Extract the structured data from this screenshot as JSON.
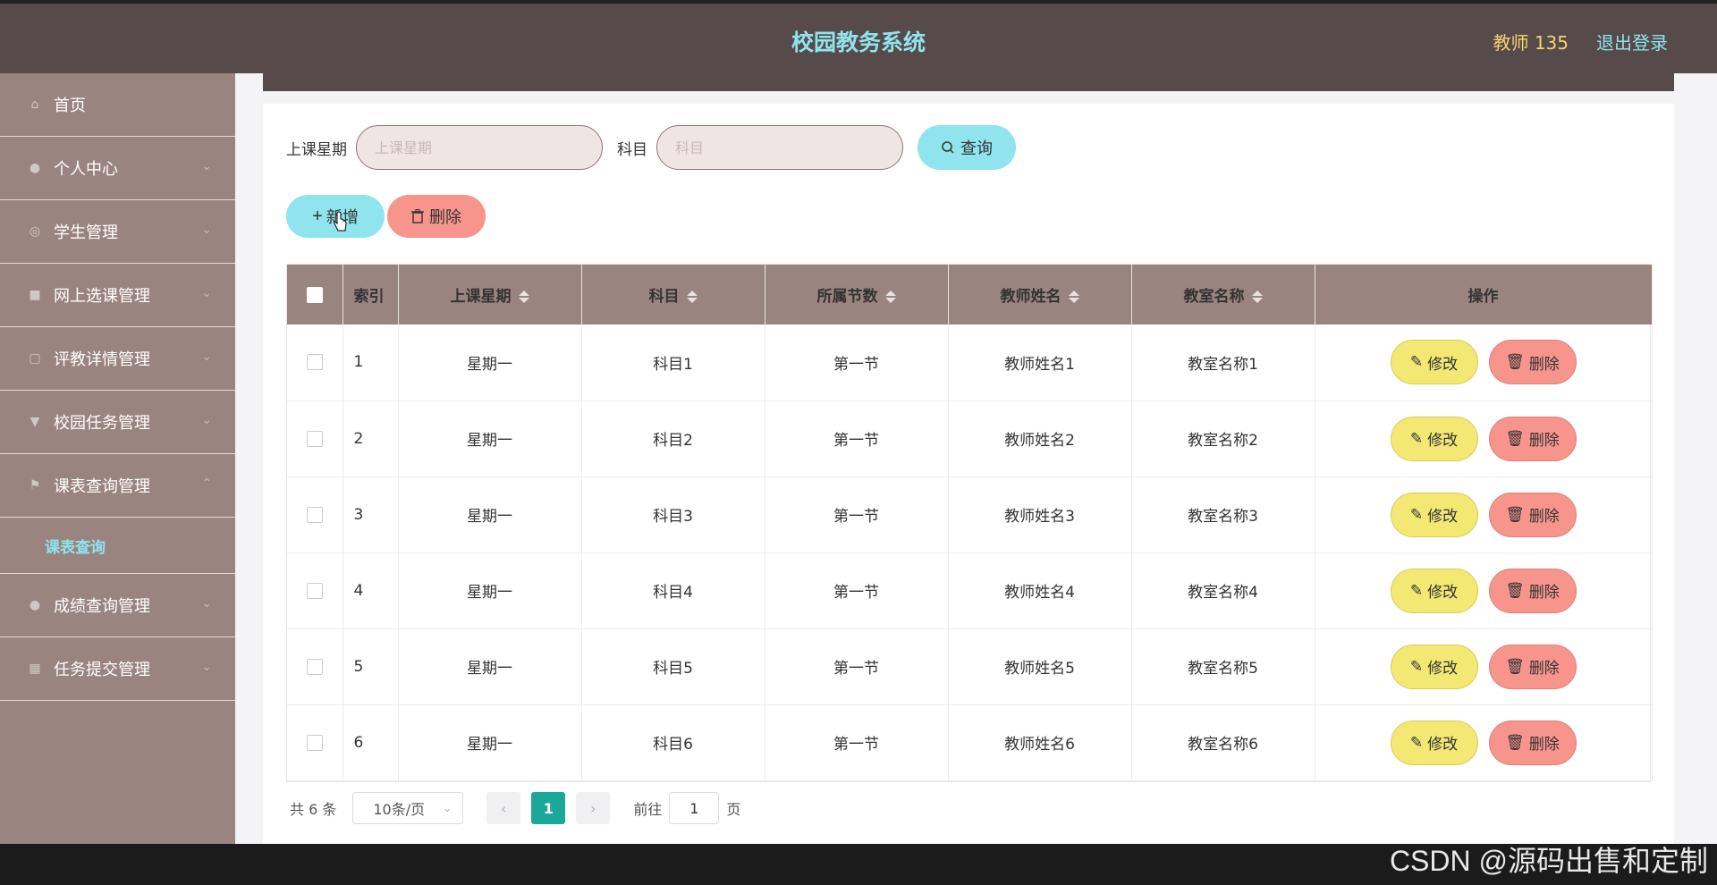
{
  "header": {
    "title": "校园教务系统",
    "user": "教师 135",
    "logout": "退出登录"
  },
  "sidebar": {
    "items": [
      {
        "label": "首页",
        "icon": "home-icon",
        "chevron": ""
      },
      {
        "label": "个人中心",
        "icon": "user-icon",
        "chevron": "⌄"
      },
      {
        "label": "学生管理",
        "icon": "compass-icon",
        "chevron": "⌄"
      },
      {
        "label": "网上选课管理",
        "icon": "video-icon",
        "chevron": "⌄"
      },
      {
        "label": "评教详情管理",
        "icon": "chat-icon",
        "chevron": "⌄"
      },
      {
        "label": "校园任务管理",
        "icon": "trophy-icon",
        "chevron": "⌄"
      },
      {
        "label": "课表查询管理",
        "icon": "flag-icon",
        "chevron": "⌃"
      }
    ],
    "submenu": {
      "label": "课表查询"
    },
    "items_after": [
      {
        "label": "成绩查询管理",
        "icon": "user-icon",
        "chevron": "⌄"
      },
      {
        "label": "任务提交管理",
        "icon": "grid-icon",
        "chevron": "⌄"
      }
    ]
  },
  "search": {
    "weekday_label": "上课星期",
    "weekday_placeholder": "上课星期",
    "subject_label": "科目",
    "subject_placeholder": "科目",
    "query_button": "查询"
  },
  "actions": {
    "add": "新增",
    "delete": "删除"
  },
  "table": {
    "headers": {
      "index": "索引",
      "weekday": "上课星期",
      "subject": "科目",
      "section": "所属节数",
      "teacher": "教师姓名",
      "classroom": "教室名称",
      "ops": "操作"
    },
    "edit_label": "修改",
    "delete_label": "删除",
    "rows": [
      {
        "index": "1",
        "weekday": "星期一",
        "subject": "科目1",
        "section": "第一节",
        "teacher": "教师姓名1",
        "classroom": "教室名称1"
      },
      {
        "index": "2",
        "weekday": "星期一",
        "subject": "科目2",
        "section": "第一节",
        "teacher": "教师姓名2",
        "classroom": "教室名称2"
      },
      {
        "index": "3",
        "weekday": "星期一",
        "subject": "科目3",
        "section": "第一节",
        "teacher": "教师姓名3",
        "classroom": "教室名称3"
      },
      {
        "index": "4",
        "weekday": "星期一",
        "subject": "科目4",
        "section": "第一节",
        "teacher": "教师姓名4",
        "classroom": "教室名称4"
      },
      {
        "index": "5",
        "weekday": "星期一",
        "subject": "科目5",
        "section": "第一节",
        "teacher": "教师姓名5",
        "classroom": "教室名称5"
      },
      {
        "index": "6",
        "weekday": "星期一",
        "subject": "科目6",
        "section": "第一节",
        "teacher": "教师姓名6",
        "classroom": "教室名称6"
      }
    ]
  },
  "pagination": {
    "total": "共 6 条",
    "page_size": "10条/页",
    "current_page": "1",
    "goto_label": "前往",
    "goto_value": "1",
    "page_suffix": "页"
  },
  "watermark": "CSDN @源码出售和定制",
  "colors": {
    "header_bg": "#574a4a",
    "sidebar_bg": "#9a8480",
    "accent_cyan": "#8fe4ee",
    "danger": "#f7958d",
    "edit_yellow": "#f2e873",
    "pager_active": "#1ba89a"
  }
}
